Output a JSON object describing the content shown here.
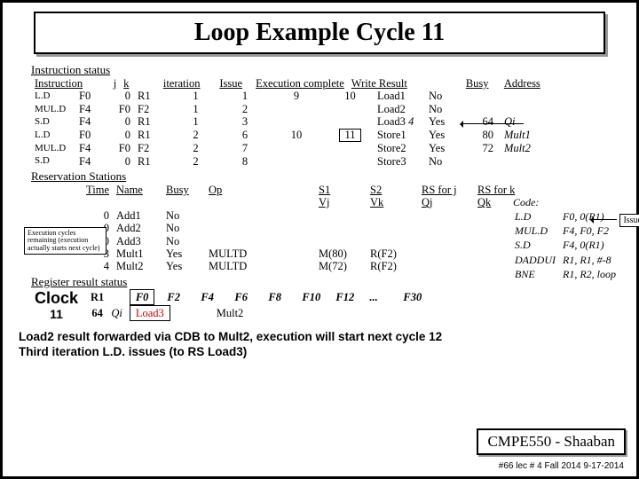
{
  "title": "Loop Example Cycle 11",
  "instr_status": {
    "heading": "Instruction status",
    "cols": [
      "Instruction",
      "j",
      "k",
      "iteration",
      "Issue",
      "Execution complete",
      "Write Result",
      "",
      "Busy",
      "Address"
    ],
    "rows": [
      {
        "op": "L.D",
        "dst": "F0",
        "j": "0",
        "k": "R1",
        "iter": "1",
        "issue": "1",
        "exec": "9",
        "write": "10",
        "unit": "Load1",
        "busy": "No",
        "addr": ""
      },
      {
        "op": "MUL.D",
        "dst": "F4",
        "j": "F0",
        "k": "F2",
        "iter": "1",
        "issue": "2",
        "exec": "",
        "write": "",
        "unit": "Load2",
        "busy": "No",
        "addr": ""
      },
      {
        "op": "S.D",
        "dst": "F4",
        "j": "0",
        "k": "R1",
        "iter": "1",
        "issue": "3",
        "exec": "",
        "write": "",
        "unit": "Load3",
        "busy": "Yes",
        "addr": "64",
        "note": "Qi",
        "index": "4"
      },
      {
        "op": "L.D",
        "dst": "F0",
        "j": "0",
        "k": "R1",
        "iter": "2",
        "issue": "6",
        "exec": "10",
        "write": "11",
        "boxed": true,
        "unit": "Store1",
        "busy": "Yes",
        "addr": "80",
        "note": "Mult1"
      },
      {
        "op": "MUL.D",
        "dst": "F4",
        "j": "F0",
        "k": "F2",
        "iter": "2",
        "issue": "7",
        "exec": "",
        "write": "",
        "unit": "Store2",
        "busy": "Yes",
        "addr": "72",
        "note": "Mult2"
      },
      {
        "op": "S.D",
        "dst": "F4",
        "j": "0",
        "k": "R1",
        "iter": "2",
        "issue": "8",
        "exec": "",
        "write": "",
        "unit": "Store3",
        "busy": "No",
        "addr": ""
      }
    ]
  },
  "rs": {
    "heading": "Reservation Stations",
    "cols": [
      "Time",
      "Name",
      "Busy",
      "Op",
      "",
      "Vj",
      "Vk",
      "Qj",
      "Qk"
    ],
    "s_labels": {
      "s1": "S1",
      "s2": "S2",
      "rsj": "RS for j",
      "rsk": "RS for k"
    },
    "rows": [
      {
        "time": "0",
        "name": "Add1",
        "busy": "No"
      },
      {
        "time": "0",
        "name": "Add2",
        "busy": "No"
      },
      {
        "time": "0",
        "name": "Add3",
        "busy": "No"
      },
      {
        "time": "3",
        "name": "Mult1",
        "busy": "Yes",
        "op": "MULTD",
        "vj": "M(80)",
        "vk": "R(F2)"
      },
      {
        "time": "4",
        "name": "Mult2",
        "busy": "Yes",
        "op": "MULTD",
        "vj": "M(72)",
        "vk": "R(F2)"
      }
    ]
  },
  "note": "Execution cycles remaining (execution actually starts next cycle)",
  "code": {
    "heading": "Code:",
    "rows": [
      [
        "L.D",
        "F0, 0(R1)"
      ],
      [
        "MUL.D",
        "F4, F0, F2"
      ],
      [
        "S.D",
        "F4, 0(R1)"
      ],
      [
        "DADDUI",
        "R1, R1, #-8"
      ],
      [
        "BNE",
        "R1, R2, loop"
      ]
    ]
  },
  "issue_badge": "Issue",
  "rrs": {
    "heading": "Register result status",
    "clock_label": "Clock",
    "clock_val": "11",
    "r1_label": "R1",
    "r1_val": "64",
    "qi": "Qi",
    "regs": [
      "F0",
      "F2",
      "F4",
      "F6",
      "F8",
      "F10",
      "F12",
      "...",
      "F30"
    ],
    "vals": [
      "Load3",
      "",
      "Mult2",
      "",
      "",
      "",
      "",
      "",
      ""
    ]
  },
  "bottom_msg_1": "Load2  result forwarded via  CDB  to  Mult2, execution will start next cycle 12",
  "bottom_msg_2": "Third iteration L.D. issues (to RS Load3)",
  "course": "CMPE550 - Shaaban",
  "footer": "#66  lec # 4 Fall 2014   9-17-2014"
}
